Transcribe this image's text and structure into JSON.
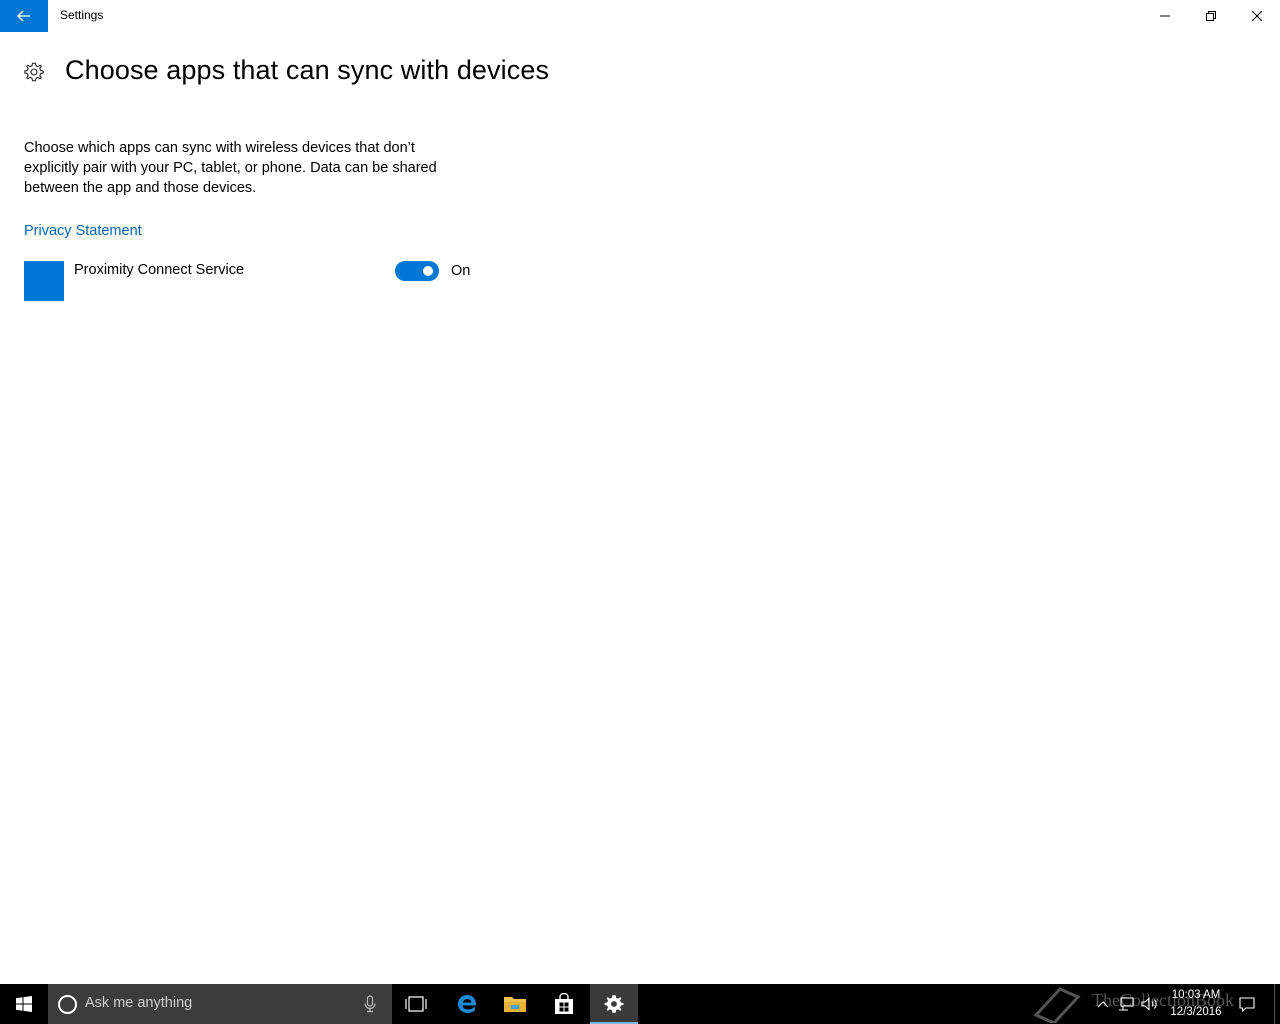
{
  "window": {
    "title": "Settings"
  },
  "page": {
    "title": "Choose apps that can sync with devices",
    "description": "Choose which apps can sync with wireless devices that don’t explicitly pair with your PC, tablet, or phone. Data can be shared between the app and those devices.",
    "privacy_link": "Privacy Statement"
  },
  "apps": [
    {
      "name": "Proximity Connect Service",
      "toggle_state": "On",
      "enabled": true
    }
  ],
  "taskbar": {
    "search_placeholder": "Ask me anything",
    "time": "10:03 AM",
    "date": "12/3/2016",
    "watermark": "TheCollectionBook"
  },
  "colors": {
    "accent": "#0078d7",
    "link": "#0063b1",
    "taskbar": "#000000"
  }
}
